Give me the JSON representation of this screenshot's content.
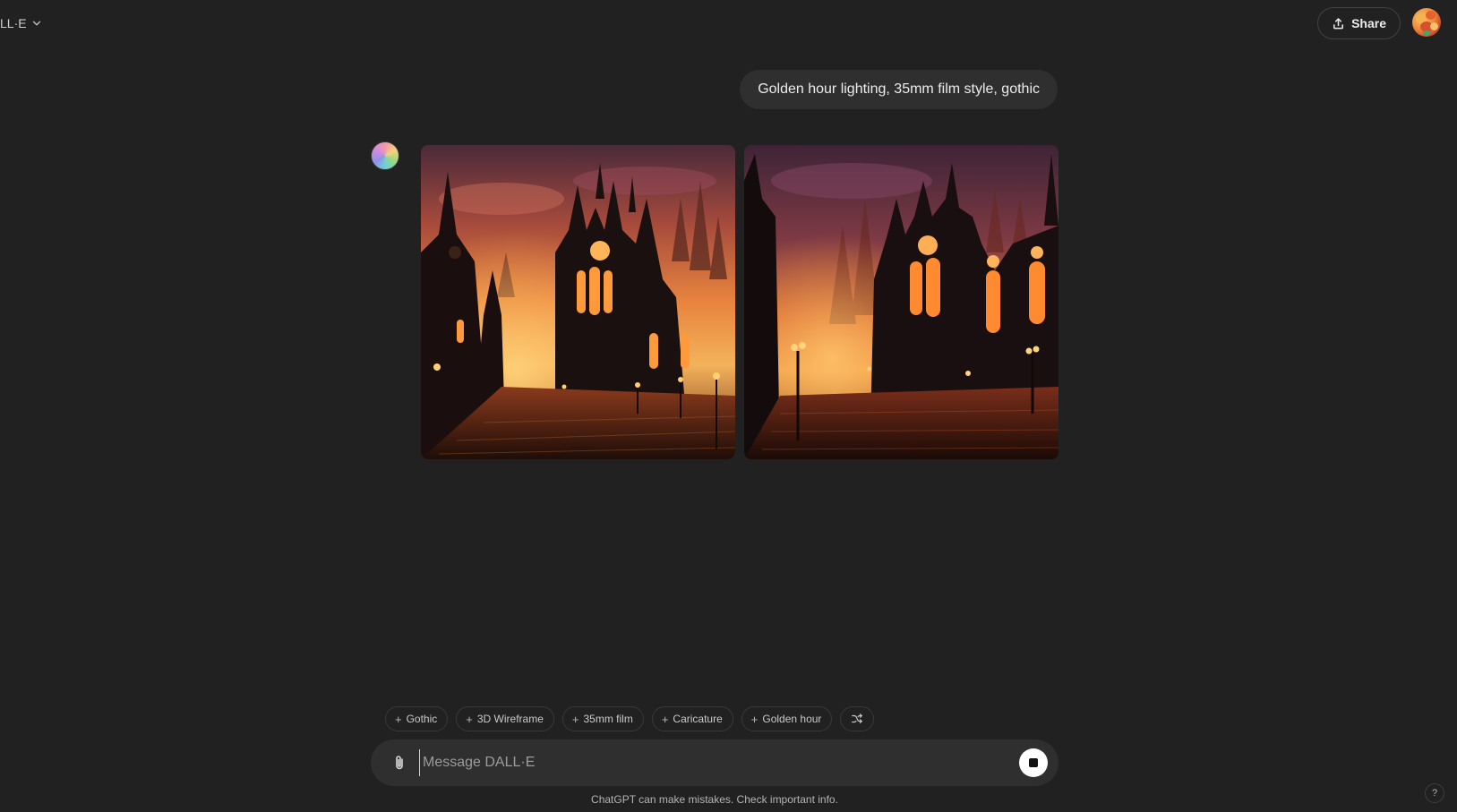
{
  "header": {
    "model_name": "LL·E",
    "model_menu_icon": "chevron-down-icon",
    "share_label": "Share",
    "share_icon": "share-upload-icon",
    "avatar_icon": "user-avatar"
  },
  "conversation": {
    "user_prompt": "Golden hour lighting, 35mm film style, gothic",
    "assistant_icon": "dalle-gradient-avatar",
    "images": [
      {
        "name": "generated-image-1",
        "subject": "gothic cathedral at golden hour"
      },
      {
        "name": "generated-image-2",
        "subject": "gothic cathedral at golden hour"
      }
    ]
  },
  "suggestions": [
    {
      "label": "Gothic"
    },
    {
      "label": "3D Wireframe"
    },
    {
      "label": "35mm film"
    },
    {
      "label": "Caricature"
    },
    {
      "label": "Golden hour"
    }
  ],
  "shuffle_icon": "shuffle-icon",
  "composer": {
    "placeholder": "Message DALL·E",
    "attach_icon": "paperclip-icon",
    "stop_icon": "stop-square-icon"
  },
  "footer": {
    "disclaimer": "ChatGPT can make mistakes. Check important info.",
    "help_label": "?"
  },
  "colors": {
    "background": "#212121",
    "bubble": "#2f2f2f",
    "text": "#ececec",
    "muted": "#b4b4b4",
    "sky_orange": "#e8743a",
    "stained_glass": "#ff8a2a"
  }
}
